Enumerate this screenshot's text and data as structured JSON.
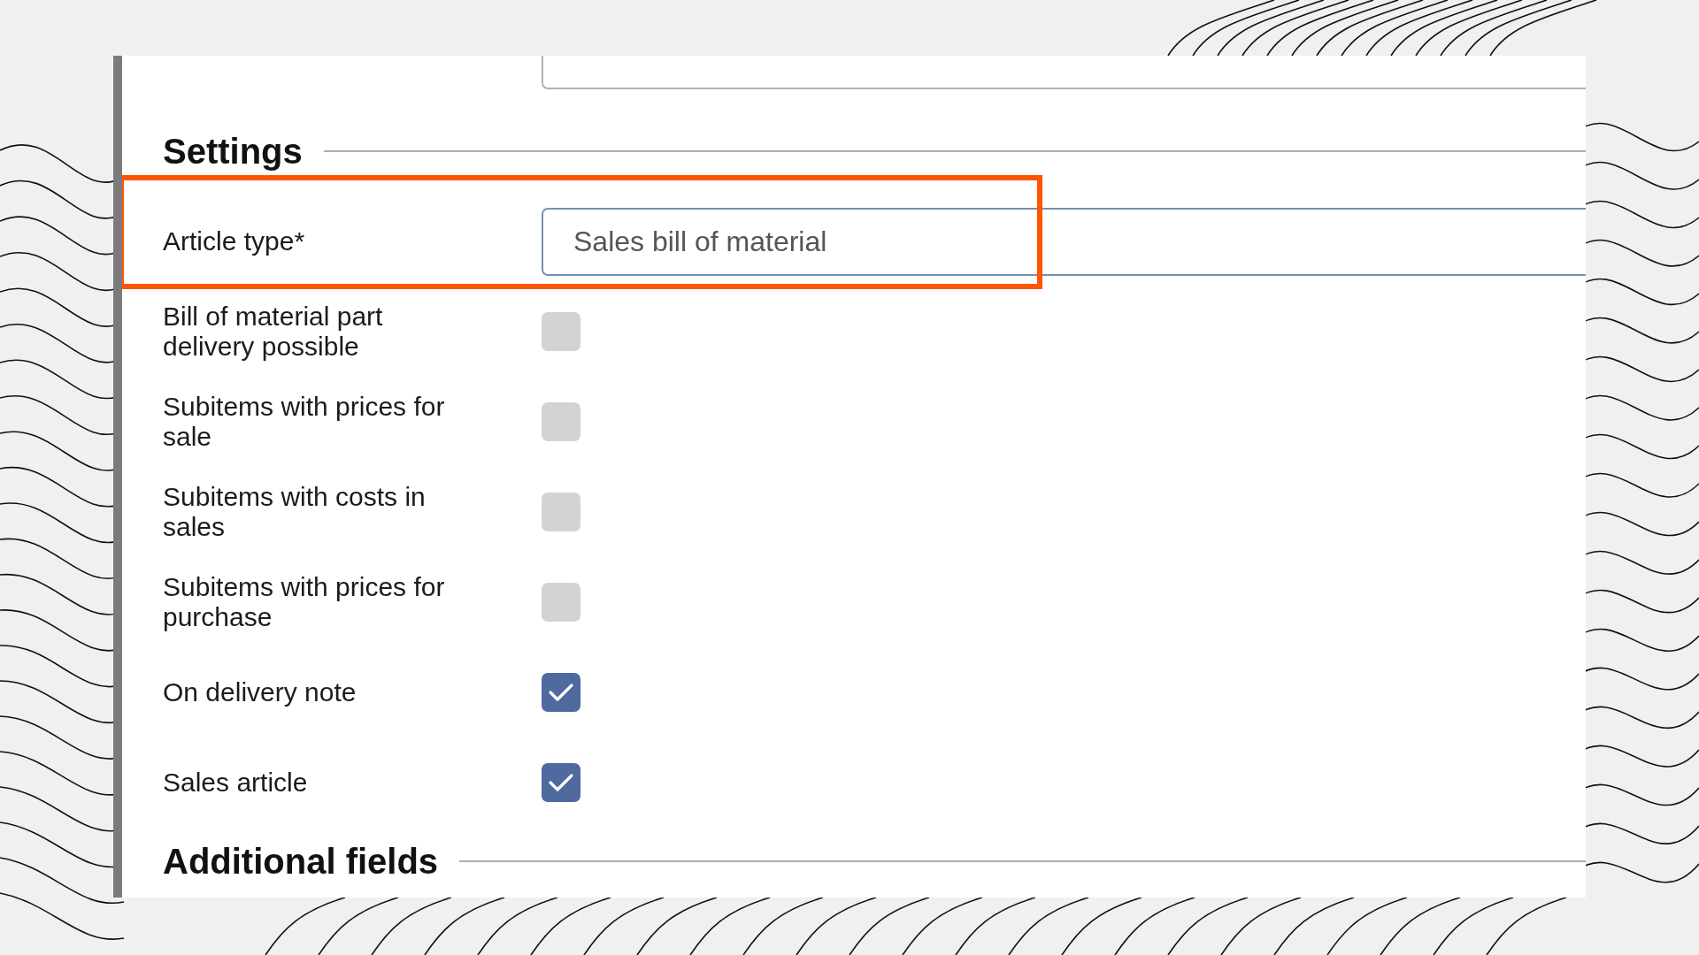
{
  "settings": {
    "title": "Settings",
    "article_type": {
      "label": "Article type*",
      "value": "Sales bill of material",
      "highlighted": true
    },
    "options": [
      {
        "label": "Bill of material part delivery possible",
        "checked": false
      },
      {
        "label": "Subitems with prices for sale",
        "checked": false
      },
      {
        "label": "Subitems with costs in sales",
        "checked": false
      },
      {
        "label": "Subitems with prices for purchase",
        "checked": false
      },
      {
        "label": "On delivery note",
        "checked": true
      },
      {
        "label": "Sales article",
        "checked": true
      }
    ]
  },
  "additional_fields": {
    "title": "Additional fields"
  }
}
